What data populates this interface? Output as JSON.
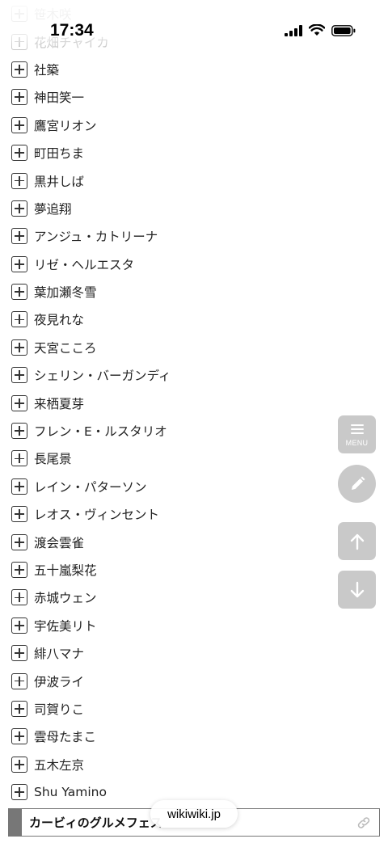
{
  "status_bar": {
    "time": "17:34"
  },
  "list_items": [
    "笹木咲",
    "花畑チャイカ",
    "社築",
    "神田笑一",
    "鷹宮リオン",
    "町田ちま",
    "黒井しば",
    "夢追翔",
    "アンジュ・カトリーナ",
    "リゼ・ヘルエスタ",
    "葉加瀬冬雪",
    "夜見れな",
    "天宮こころ",
    "シェリン・バーガンディ",
    "来栖夏芽",
    "フレン・E・ルスタリオ",
    "長尾景",
    "レイン・パターソン",
    "レオス・ヴィンセント",
    "渡会雲雀",
    "五十嵐梨花",
    "赤城ウェン",
    "宇佐美リト",
    "緋八マナ",
    "伊波ライ",
    "司賀りこ",
    "雲母たまこ",
    "五木左京",
    "Shu Yamino"
  ],
  "floating_buttons": {
    "menu_label": "MENU"
  },
  "section": {
    "title": "カービィのグルメフェス"
  },
  "browser": {
    "url": "wikiwiki.jp"
  },
  "colors": {
    "fab": "#c9c9c9",
    "section_bar": "#777777"
  },
  "icons": [
    "signal-icon",
    "wifi-icon",
    "battery-icon",
    "menu-icon",
    "pencil-icon",
    "arrow-up-icon",
    "arrow-down-icon",
    "link-icon",
    "plus-box-icon"
  ]
}
